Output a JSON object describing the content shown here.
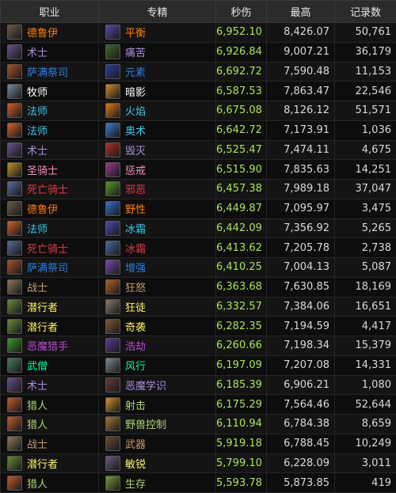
{
  "headers": {
    "class": "职业",
    "spec": "专精",
    "dps": "秒伤",
    "max": "最高",
    "records": "记录数"
  },
  "colors": {
    "德鲁伊": "#ff7c0a",
    "术士": "#a98de0",
    "萨满祭司": "#2a7fe0",
    "牧师": "#ffffff",
    "法师": "#3fc7eb",
    "圣骑士": "#f48cba",
    "死亡骑士": "#e03a4a",
    "战士": "#c69b6d",
    "潜行者": "#fff468",
    "恶魔猎手": "#b54ad0",
    "武僧": "#00ff98",
    "猎人": "#aad372",
    "dps_value": "#a6e35a",
    "header_bg": "#2b2b2b"
  },
  "rows": [
    {
      "class": "德鲁伊",
      "spec": "平衡",
      "dps": "6,952.10",
      "max": "8,426.07",
      "records": "50,761",
      "class_icon": "druid-icon",
      "spec_icon": "balance-icon",
      "ci": "#6b5a44",
      "si": "#5a4ab0"
    },
    {
      "class": "术士",
      "spec": "痛苦",
      "dps": "6,926.84",
      "max": "9,007.21",
      "records": "36,179",
      "class_icon": "warlock-icon",
      "spec_icon": "affliction-icon",
      "ci": "#6a4f8a",
      "si": "#3f6a2a"
    },
    {
      "class": "萨满祭司",
      "spec": "元素",
      "dps": "6,692.72",
      "max": "7,590.48",
      "records": "11,153",
      "class_icon": "shaman-icon",
      "spec_icon": "elemental-icon",
      "ci": "#a8522a",
      "si": "#2a3fa0"
    },
    {
      "class": "牧师",
      "spec": "暗影",
      "dps": "6,587.53",
      "max": "7,863.47",
      "records": "22,546",
      "class_icon": "priest-icon",
      "spec_icon": "shadow-icon",
      "ci": "#7a8a9a",
      "si": "#d08a2a"
    },
    {
      "class": "法师",
      "spec": "火焰",
      "dps": "6,675.08",
      "max": "8,126.12",
      "records": "51,571",
      "class_icon": "mage-icon",
      "spec_icon": "fire-icon",
      "ci": "#d0602a",
      "si": "#e07a1a"
    },
    {
      "class": "法师",
      "spec": "奥术",
      "dps": "6,642.72",
      "max": "7,173.91",
      "records": "1,036",
      "class_icon": "mage-icon",
      "spec_icon": "arcane-icon",
      "ci": "#d0602a",
      "si": "#3a7ad0"
    },
    {
      "class": "术士",
      "spec": "毁灭",
      "dps": "6,525.47",
      "max": "7,474.11",
      "records": "4,675",
      "class_icon": "warlock-icon",
      "spec_icon": "destruction-icon",
      "ci": "#6a4f8a",
      "si": "#b0302a"
    },
    {
      "class": "圣骑士",
      "spec": "惩戒",
      "dps": "6,515.90",
      "max": "7,835.63",
      "records": "14,251",
      "class_icon": "paladin-icon",
      "spec_icon": "retribution-icon",
      "ci": "#c0902a",
      "si": "#9a3a8a"
    },
    {
      "class": "死亡骑士",
      "spec": "邪恶",
      "dps": "6,457.38",
      "max": "7,989.18",
      "records": "37,047",
      "class_icon": "death-knight-icon",
      "spec_icon": "unholy-icon",
      "ci": "#5a6a9a",
      "si": "#5a9a2a"
    },
    {
      "class": "德鲁伊",
      "spec": "野性",
      "dps": "6,449.87",
      "max": "7,095.97",
      "records": "3,475",
      "class_icon": "druid-icon",
      "spec_icon": "feral-icon",
      "ci": "#6b5a44",
      "si": "#3a6ad0"
    },
    {
      "class": "法师",
      "spec": "冰霜",
      "dps": "6,442.09",
      "max": "7,356.92",
      "records": "5,265",
      "class_icon": "mage-icon",
      "spec_icon": "frost-icon",
      "ci": "#d0602a",
      "si": "#4a4ab0"
    },
    {
      "class": "死亡骑士",
      "spec": "冰霜",
      "dps": "6,413.62",
      "max": "7,205.78",
      "records": "2,738",
      "class_icon": "death-knight-icon",
      "spec_icon": "frost-dk-icon",
      "ci": "#5a6a9a",
      "si": "#4a6aa0"
    },
    {
      "class": "萨满祭司",
      "spec": "增强",
      "dps": "6,410.25",
      "max": "7,004.13",
      "records": "5,087",
      "class_icon": "shaman-icon",
      "spec_icon": "enhancement-icon",
      "ci": "#a8522a",
      "si": "#7a4ab0"
    },
    {
      "class": "战士",
      "spec": "狂怒",
      "dps": "6,363.68",
      "max": "7,630.85",
      "records": "18,169",
      "class_icon": "warrior-icon",
      "spec_icon": "fury-icon",
      "ci": "#8a7a5a",
      "si": "#b0602a"
    },
    {
      "class": "潜行者",
      "spec": "狂徒",
      "dps": "6,332.57",
      "max": "7,384.06",
      "records": "16,651",
      "class_icon": "rogue-icon",
      "spec_icon": "outlaw-icon",
      "ci": "#6a8a3a",
      "si": "#8a7a6a"
    },
    {
      "class": "潜行者",
      "spec": "奇袭",
      "dps": "6,282.35",
      "max": "7,194.59",
      "records": "4,417",
      "class_icon": "rogue-icon",
      "spec_icon": "assassination-icon",
      "ci": "#6a8a3a",
      "si": "#7a5a3a"
    },
    {
      "class": "恶魔猎手",
      "spec": "浩劫",
      "dps": "6,260.66",
      "max": "7,198.34",
      "records": "15,379",
      "class_icon": "demon-hunter-icon",
      "spec_icon": "havoc-icon",
      "ci": "#3a9a2a",
      "si": "#5a3a9a"
    },
    {
      "class": "武僧",
      "spec": "风行",
      "dps": "6,197.09",
      "max": "7,207.08",
      "records": "14,331",
      "class_icon": "monk-icon",
      "spec_icon": "windwalker-icon",
      "ci": "#4a7a5a",
      "si": "#7a8a9a"
    },
    {
      "class": "术士",
      "spec": "恶魔学识",
      "dps": "6,185.39",
      "max": "6,906.21",
      "records": "1,080",
      "class_icon": "warlock-icon",
      "spec_icon": "demonology-icon",
      "ci": "#6a4f8a",
      "si": "#6a3a3a"
    },
    {
      "class": "猎人",
      "spec": "射击",
      "dps": "6,175.29",
      "max": "7,564.46",
      "records": "52,644",
      "class_icon": "hunter-icon",
      "spec_icon": "marksmanship-icon",
      "ci": "#c05a2a",
      "si": "#d0902a"
    },
    {
      "class": "猎人",
      "spec": "野兽控制",
      "dps": "6,110.94",
      "max": "6,784.38",
      "records": "8,659",
      "class_icon": "hunter-icon",
      "spec_icon": "beast-mastery-icon",
      "ci": "#c05a2a",
      "si": "#a07a3a"
    },
    {
      "class": "战士",
      "spec": "武器",
      "dps": "5,919.18",
      "max": "6,788.45",
      "records": "10,249",
      "class_icon": "warrior-icon",
      "spec_icon": "arms-icon",
      "ci": "#8a7a5a",
      "si": "#6a4a3a"
    },
    {
      "class": "潜行者",
      "spec": "敏锐",
      "dps": "5,799.10",
      "max": "6,228.09",
      "records": "3,011",
      "class_icon": "rogue-icon",
      "spec_icon": "subtlety-icon",
      "ci": "#6a8a3a",
      "si": "#6a5a7a"
    },
    {
      "class": "猎人",
      "spec": "生存",
      "dps": "5,593.78",
      "max": "5,873.85",
      "records": "419",
      "class_icon": "hunter-icon",
      "spec_icon": "survival-icon",
      "ci": "#c05a2a",
      "si": "#7a9a3a"
    }
  ]
}
